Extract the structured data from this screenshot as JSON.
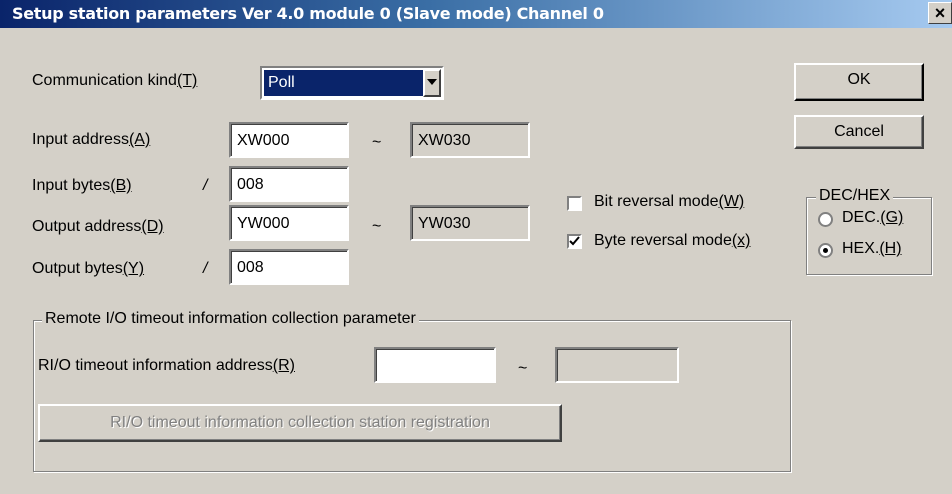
{
  "window": {
    "title": "Setup station parameters Ver 4.0 module 0 (Slave mode) Channel 0",
    "close_glyph": "×"
  },
  "communication_kind": {
    "label": "Communication kind",
    "hotkey": "(T)",
    "selected": "Poll"
  },
  "input_address": {
    "label": "Input address",
    "hotkey": "(A)",
    "start": "XW000",
    "tilde": "~",
    "end": "XW030"
  },
  "input_bytes": {
    "label": "Input bytes",
    "hotkey": "(B)",
    "slash": "/",
    "value": "008"
  },
  "output_address": {
    "label": "Output address",
    "hotkey": "(D)",
    "start": "YW000",
    "tilde": "~",
    "end": "YW030"
  },
  "output_bytes": {
    "label": "Output bytes",
    "hotkey": "(Y)",
    "slash": "/",
    "value": "008"
  },
  "bit_reversal": {
    "label": "Bit reversal mode",
    "hotkey": "(W)",
    "checked": false
  },
  "byte_reversal": {
    "label": "Byte reversal mode",
    "hotkey": "(x)",
    "checked": true
  },
  "buttons": {
    "ok": "OK",
    "cancel": "Cancel"
  },
  "dechex": {
    "legend": "DEC/HEX",
    "dec_label": "DEC.",
    "dec_hotkey": "(G)",
    "hex_label": "HEX.",
    "hex_hotkey": "(H)",
    "selected": "HEX"
  },
  "remote_io": {
    "legend": "Remote I/O timeout information collection parameter",
    "address_label": "RI/O timeout information address",
    "address_hotkey": "(R)",
    "address_start": "",
    "tilde": "~",
    "address_end": "",
    "registration_button": "RI/O timeout information collection station registration"
  }
}
